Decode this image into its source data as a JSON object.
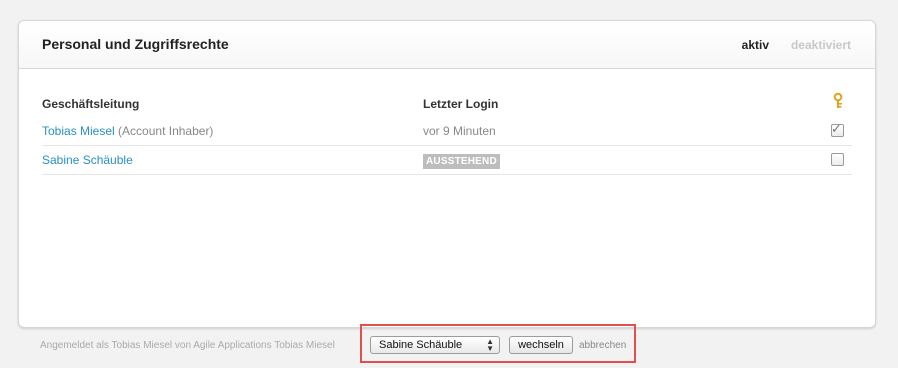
{
  "panel": {
    "title": "Personal und Zugriffsrechte",
    "filter_active": "aktiv",
    "filter_inactive": "deaktiviert"
  },
  "table": {
    "col_name": "Geschäftsleitung",
    "col_login": "Letzter Login",
    "key_icon": "key-icon",
    "rows": [
      {
        "name": "Tobias Miesel",
        "role": "(Account Inhaber)",
        "login": "vor 9 Minuten",
        "checked": true
      },
      {
        "name": "Sabine Schäuble",
        "role": "",
        "badge": "AUSSTEHEND",
        "checked": false
      }
    ]
  },
  "footer": {
    "text": "Angemeldet als Tobias Miesel von Agile Applications Tobias Miesel",
    "select_value": "Sabine Schäuble",
    "switch_label": "wechseln",
    "cancel_label": "abbrechen"
  },
  "colors": {
    "link": "#2a8fc7",
    "highlight": "#e0514d",
    "key": "#e3a21a"
  }
}
